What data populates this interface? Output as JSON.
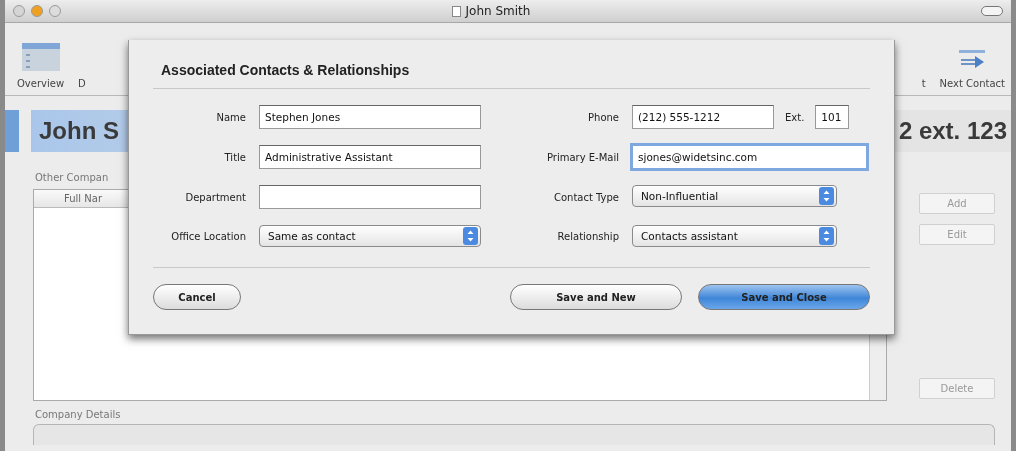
{
  "window": {
    "title": "John Smith"
  },
  "toolbar": [
    {
      "label": "Overview",
      "kind": "list"
    },
    {
      "label": "D",
      "kind": "plain"
    },
    {
      "label": "t",
      "kind": "plain"
    },
    {
      "label": "Next Contact",
      "kind": "arrow"
    }
  ],
  "header": {
    "name": "John S",
    "phone": "2 ext. 123"
  },
  "other_companies": {
    "label": "Other Compan",
    "columns": [
      "Full Nar"
    ],
    "buttons": [
      "Add",
      "Edit",
      "Delete"
    ]
  },
  "company_details": {
    "label": "Company Details"
  },
  "sheet": {
    "title": "Associated Contacts & Relationships",
    "rows": [
      {
        "left": {
          "label": "Name",
          "kind": "text",
          "value": "Stephen Jones",
          "focused": false
        },
        "right": {
          "label": "Phone",
          "kind": "text",
          "value": "(212) 555-1212",
          "focused": false,
          "ext": {
            "label": "Ext.",
            "value": "101"
          }
        }
      },
      {
        "left": {
          "label": "Title",
          "kind": "text",
          "value": "Administrative Assistant",
          "focused": false
        },
        "right": {
          "label": "Primary E-Mail",
          "kind": "text",
          "value": "sjones@widetsinc.com",
          "focused": true
        }
      },
      {
        "left": {
          "label": "Department",
          "kind": "text",
          "focused": false
        },
        "right": {
          "label": "Contact Type",
          "kind": "popup",
          "value": "Non-Influential"
        }
      },
      {
        "left": {
          "label": "Office Location",
          "kind": "popup",
          "value": "Same as contact"
        },
        "right": {
          "label": "Relationship",
          "kind": "popup",
          "value": "Contacts assistant"
        }
      }
    ],
    "buttons": [
      {
        "label": "Cancel",
        "default": false
      },
      {
        "label": "Save and New",
        "default": false
      },
      {
        "label": "Save and Close",
        "default": true
      }
    ]
  }
}
